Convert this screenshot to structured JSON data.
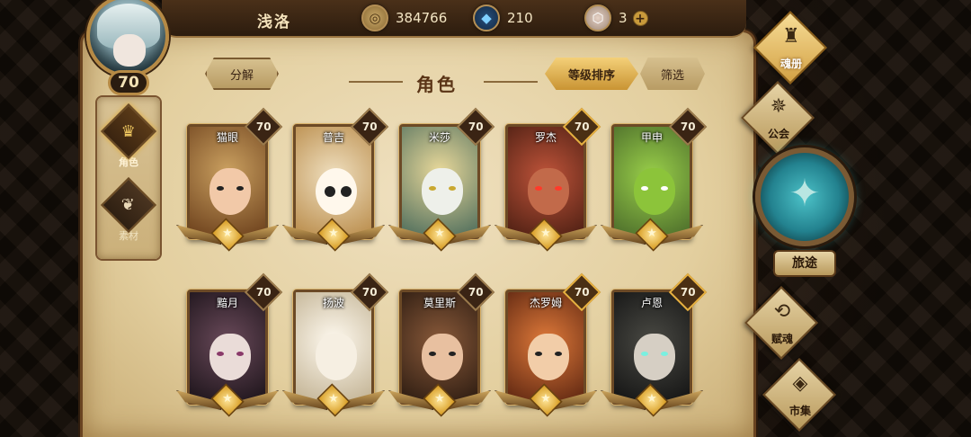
{
  "player": {
    "name": "浅洛",
    "level": "70"
  },
  "resources": {
    "coins": {
      "icon": "coin-icon",
      "value": "384766"
    },
    "crystals": {
      "icon": "crystal-icon",
      "value": "210"
    },
    "gems": {
      "icon": "gem-icon",
      "value": "3",
      "add_label": "+"
    }
  },
  "sidebar": {
    "items": [
      {
        "label": "角色",
        "icon": "helmet-icon"
      },
      {
        "label": "素材",
        "icon": "wings-icon"
      }
    ]
  },
  "header": {
    "decompose_label": "分解",
    "title": "角色",
    "sort_label": "等级排序",
    "filter_label": "筛选"
  },
  "heroes": [
    {
      "name": "猫眼",
      "level": "70"
    },
    {
      "name": "普吉",
      "level": "70"
    },
    {
      "name": "米莎",
      "level": "70"
    },
    {
      "name": "罗杰",
      "level": "70"
    },
    {
      "name": "甲申",
      "level": "70"
    },
    {
      "name": "黯月",
      "level": "70"
    },
    {
      "name": "扬波",
      "level": "70"
    },
    {
      "name": "莫里斯",
      "level": "70"
    },
    {
      "name": "杰罗姆",
      "level": "70"
    },
    {
      "name": "卢恩",
      "level": "70"
    }
  ],
  "right_nav": {
    "soul_book": "魂册",
    "guild": "公会",
    "journey": "旅途",
    "talent_soul": "赋魂",
    "market": "市集"
  },
  "colors": {
    "accent_gold": "#e6b040",
    "parchment": "#e3cf9f",
    "journey_teal": "#4cc2c8"
  }
}
